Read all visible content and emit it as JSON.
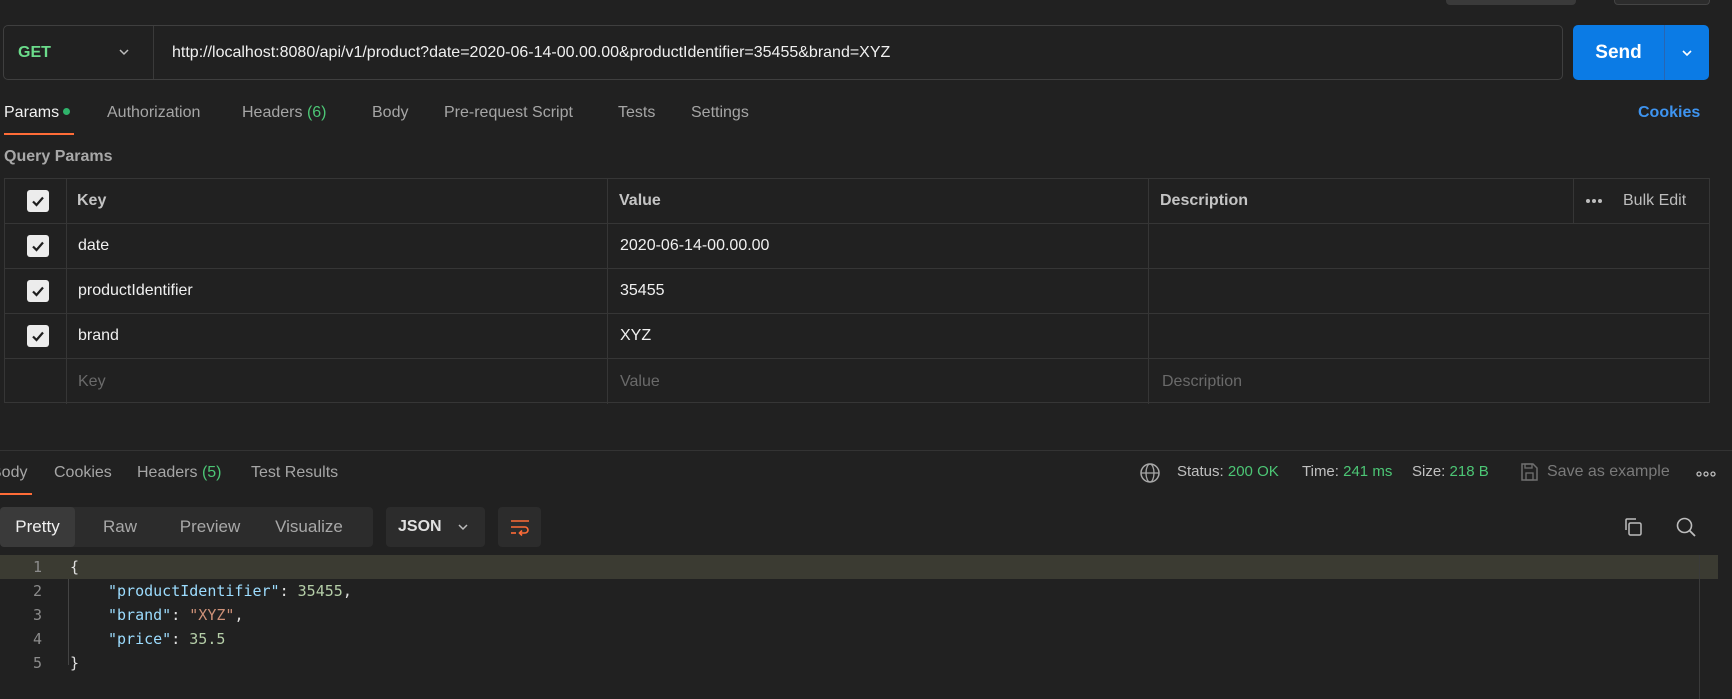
{
  "request": {
    "method": "GET",
    "url": "http://localhost:8080/api/v1/product?date=2020-06-14-00.00.00&productIdentifier=35455&brand=XYZ",
    "send_label": "Send"
  },
  "request_tabs": {
    "params": "Params",
    "authorization": "Authorization",
    "headers": "Headers",
    "headers_count": "(6)",
    "body": "Body",
    "prerequest": "Pre-request Script",
    "tests": "Tests",
    "settings": "Settings",
    "cookies": "Cookies"
  },
  "query_params": {
    "title": "Query Params",
    "columns": {
      "key": "Key",
      "value": "Value",
      "description": "Description"
    },
    "bulk_edit": "Bulk Edit",
    "rows": [
      {
        "key": "date",
        "value": "2020-06-14-00.00.00",
        "checked": true
      },
      {
        "key": "productIdentifier",
        "value": "35455",
        "checked": true
      },
      {
        "key": "brand",
        "value": "XYZ",
        "checked": true
      }
    ],
    "placeholders": {
      "key": "Key",
      "value": "Value",
      "description": "Description"
    }
  },
  "response_tabs": {
    "body": "Body",
    "cookies": "Cookies",
    "headers": "Headers",
    "headers_count": "(5)",
    "test_results": "Test Results"
  },
  "response_status": {
    "status_label": "Status:",
    "status_value": "200 OK",
    "time_label": "Time:",
    "time_value": "241 ms",
    "size_label": "Size:",
    "size_value": "218 B",
    "save_example": "Save as example"
  },
  "view": {
    "modes": [
      "Pretty",
      "Raw",
      "Preview",
      "Visualize"
    ],
    "selected": "Pretty",
    "format": "JSON"
  },
  "response_body": {
    "line_numbers": [
      "1",
      "2",
      "3",
      "4",
      "5"
    ],
    "open_brace": "{",
    "close_brace": "}",
    "fields": [
      {
        "key": "\"productIdentifier\"",
        "value": "35455",
        "sep": ","
      },
      {
        "key": "\"brand\"",
        "value": "\"XYZ\"",
        "sep": ","
      },
      {
        "key": "\"price\"",
        "value": "35.5",
        "sep": ""
      }
    ]
  },
  "colors": {
    "accent": "#0b7be5",
    "method_get": "#6bdc8b",
    "active_tab_underline": "#ff6c37",
    "status_ok": "#4cc675",
    "link": "#3e94f0"
  }
}
